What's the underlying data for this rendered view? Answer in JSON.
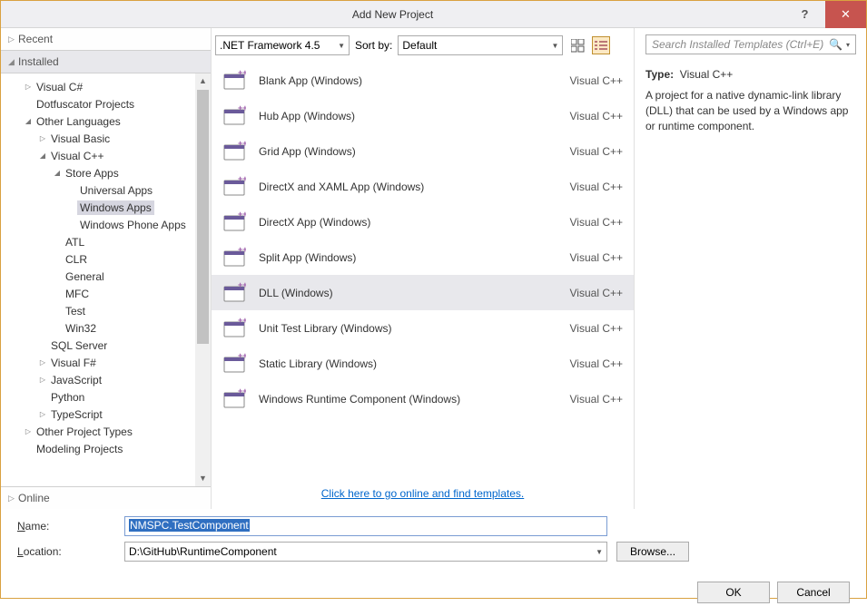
{
  "window": {
    "title": "Add New Project"
  },
  "left": {
    "panels": {
      "recent": "Recent",
      "installed": "Installed",
      "online": "Online"
    },
    "tree": [
      {
        "label": "Visual C#",
        "indent": 1,
        "tri": "▷"
      },
      {
        "label": "Dotfuscator Projects",
        "indent": 1,
        "tri": ""
      },
      {
        "label": "Other Languages",
        "indent": 1,
        "tri": "◢"
      },
      {
        "label": "Visual Basic",
        "indent": 2,
        "tri": "▷"
      },
      {
        "label": "Visual C++",
        "indent": 2,
        "tri": "◢"
      },
      {
        "label": "Store Apps",
        "indent": 3,
        "tri": "◢"
      },
      {
        "label": "Universal Apps",
        "indent": 4,
        "tri": ""
      },
      {
        "label": "Windows Apps",
        "indent": 4,
        "tri": "",
        "selected": true
      },
      {
        "label": "Windows Phone Apps",
        "indent": 4,
        "tri": ""
      },
      {
        "label": "ATL",
        "indent": 3,
        "tri": ""
      },
      {
        "label": "CLR",
        "indent": 3,
        "tri": ""
      },
      {
        "label": "General",
        "indent": 3,
        "tri": ""
      },
      {
        "label": "MFC",
        "indent": 3,
        "tri": ""
      },
      {
        "label": "Test",
        "indent": 3,
        "tri": ""
      },
      {
        "label": "Win32",
        "indent": 3,
        "tri": ""
      },
      {
        "label": "SQL Server",
        "indent": 2,
        "tri": ""
      },
      {
        "label": "Visual F#",
        "indent": 2,
        "tri": "▷"
      },
      {
        "label": "JavaScript",
        "indent": 2,
        "tri": "▷"
      },
      {
        "label": "Python",
        "indent": 2,
        "tri": ""
      },
      {
        "label": "TypeScript",
        "indent": 2,
        "tri": "▷"
      },
      {
        "label": "Other Project Types",
        "indent": 1,
        "tri": "▷"
      },
      {
        "label": "Modeling Projects",
        "indent": 1,
        "tri": ""
      }
    ]
  },
  "toolbar": {
    "framework": ".NET Framework 4.5",
    "sortby_label": "Sort by:",
    "sortby_value": "Default",
    "search_placeholder": "Search Installed Templates (Ctrl+E)"
  },
  "templates": [
    {
      "name": "Blank App (Windows)",
      "lang": "Visual C++"
    },
    {
      "name": "Hub App (Windows)",
      "lang": "Visual C++"
    },
    {
      "name": "Grid App (Windows)",
      "lang": "Visual C++"
    },
    {
      "name": "DirectX and XAML App (Windows)",
      "lang": "Visual C++"
    },
    {
      "name": "DirectX App (Windows)",
      "lang": "Visual C++"
    },
    {
      "name": "Split App (Windows)",
      "lang": "Visual C++"
    },
    {
      "name": "DLL (Windows)",
      "lang": "Visual C++",
      "selected": true
    },
    {
      "name": "Unit Test Library (Windows)",
      "lang": "Visual C++"
    },
    {
      "name": "Static Library (Windows)",
      "lang": "Visual C++"
    },
    {
      "name": "Windows Runtime Component (Windows)",
      "lang": "Visual C++"
    }
  ],
  "online_link": "Click here to go online and find templates.",
  "right": {
    "type_label": "Type:",
    "type_value": "Visual C++",
    "description": "A project for a native dynamic-link library (DLL) that can be used by a Windows app or runtime component."
  },
  "form": {
    "name_label": "Name:",
    "name_value": "NMSPC.TestComponent",
    "location_label": "Location:",
    "location_value": "D:\\GitHub\\RuntimeComponent",
    "browse_label": "Browse..."
  },
  "buttons": {
    "ok": "OK",
    "cancel": "Cancel"
  }
}
